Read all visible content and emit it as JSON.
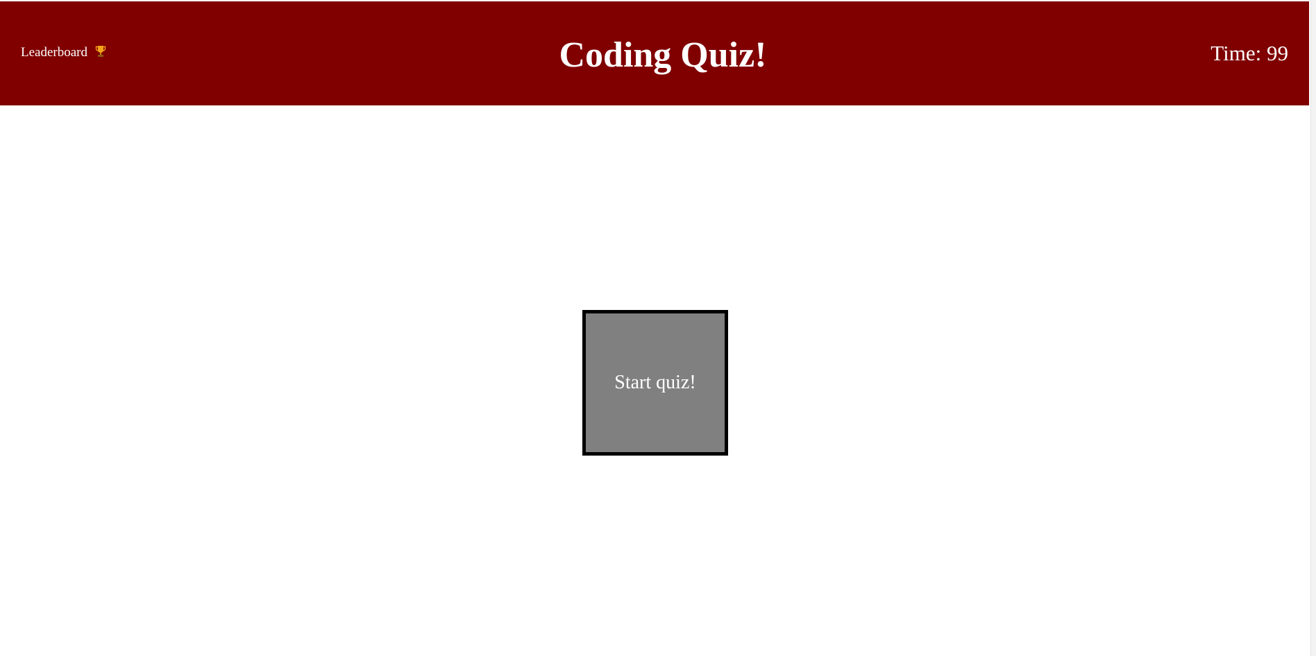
{
  "header": {
    "leaderboard_label": "Leaderboard",
    "leaderboard_icon": "trophy-icon",
    "title": "Coding Quiz!",
    "timer_text": "Time: 99",
    "background_color": "#800000"
  },
  "main": {
    "start_button_label": "Start quiz!",
    "start_button_color": "#808080"
  }
}
